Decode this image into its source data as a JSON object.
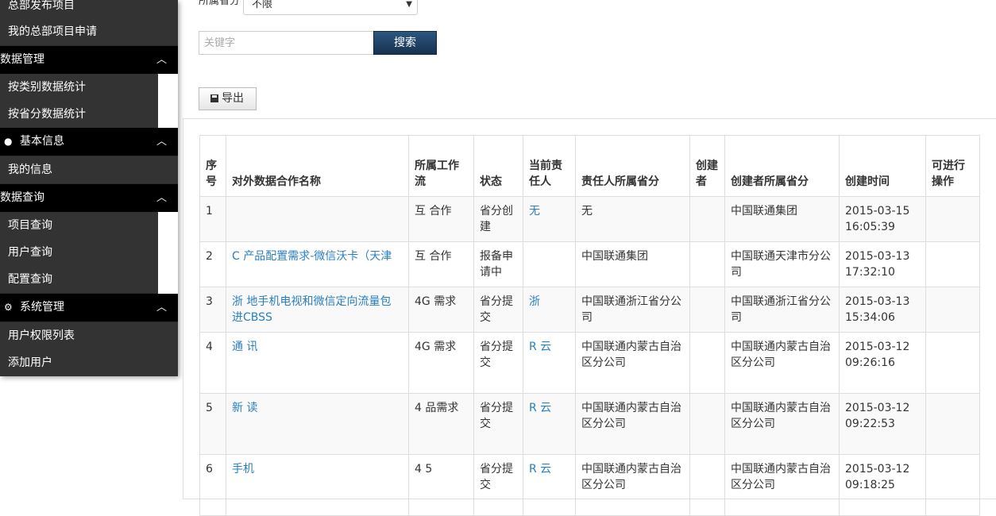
{
  "sidebar": {
    "items_top": [
      "总部发布项目",
      "我的总部项目申请"
    ],
    "groups": [
      {
        "title": "数据管理",
        "icon": "",
        "items": [
          "按类别数据统计",
          "按省分数据统计"
        ]
      },
      {
        "title": "基本信息",
        "icon": "user-icon",
        "items": [
          "我的信息"
        ]
      },
      {
        "title": "数据查询",
        "icon": "",
        "items": [
          "项目查询",
          "用户查询",
          "配置查询"
        ]
      },
      {
        "title": "系统管理",
        "icon": "gear-icon",
        "items": [
          "用户权限列表",
          "添加用户"
        ]
      }
    ]
  },
  "filter": {
    "province_label": "所属省分",
    "province_value": "不限",
    "keyword_placeholder": "关键字",
    "search_label": "搜索",
    "export_label": "导出"
  },
  "table": {
    "headers": [
      "序号",
      "对外数据合作名称",
      "所属工作流",
      "状态",
      "当前责任人",
      "责任人所属省分",
      "创建者",
      "创建者所属省分",
      "创建时间",
      "可进行操作"
    ],
    "rows": [
      {
        "no": "1",
        "name": "",
        "flow": "互 合作",
        "status": "省分创建",
        "owner": "无",
        "owner_prov": "无",
        "creator_prov": "中国联通集团",
        "time": "2015-03-15 16:05:39"
      },
      {
        "no": "2",
        "name": "C 产品配置需求-微信沃卡（天津",
        "flow": "互 合作",
        "status": "报备申请中",
        "owner": "",
        "owner_prov": "中国联通集团",
        "creator_prov": "中国联通天津市分公司",
        "time": "2015-03-13 17:32:10"
      },
      {
        "no": "3",
        "name": "浙 地手机电视和微信定向流量包 进CBSS",
        "flow": "4G 需求",
        "status": "省分提交",
        "owner": "浙",
        "owner_prov": "中国联通浙江省分公司",
        "creator_prov": "中国联通浙江省分公司",
        "time": "2015-03-13 15:34:06"
      },
      {
        "no": "4",
        "name": "通 讯",
        "flow": "4G 需求",
        "status": "省分提交",
        "owner": "R 云",
        "owner_prov": "中国联通内蒙古自治区分公司",
        "creator_prov": "中国联通内蒙古自治区分公司",
        "time": "2015-03-12 09:26:16"
      },
      {
        "no": "5",
        "name": "新 读",
        "flow": "4 品需求",
        "status": "省分提交",
        "owner": "R 云",
        "owner_prov": "中国联通内蒙古自治区分公司",
        "creator_prov": "中国联通内蒙古自治区分公司",
        "time": "2015-03-12 09:22:53"
      },
      {
        "no": "6",
        "name": "手机",
        "flow": "4 5",
        "status": "省分提交",
        "owner": "R 云",
        "owner_prov": "中国联通内蒙古自治区分公司",
        "creator_prov": "中国联通内蒙古自治区分公司",
        "time": "2015-03-12 09:18:25"
      }
    ]
  }
}
